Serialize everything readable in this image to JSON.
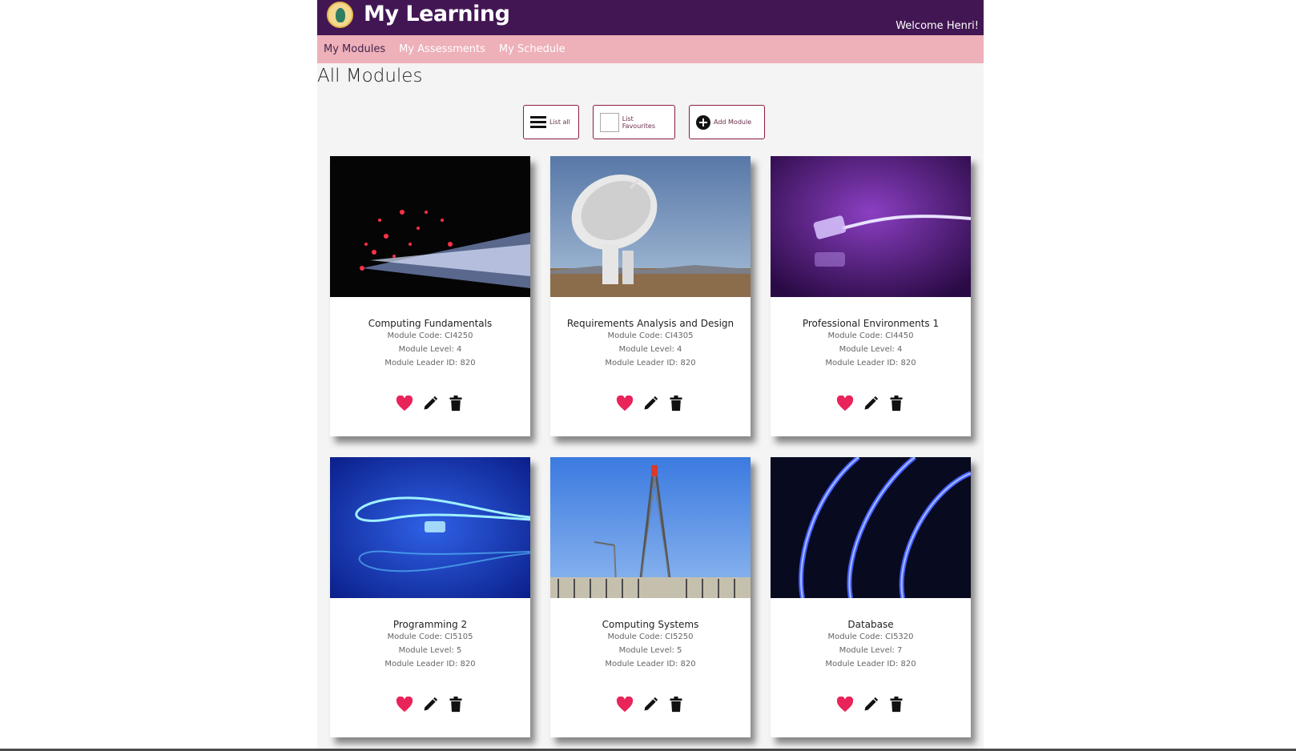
{
  "header": {
    "title": "My Learning",
    "welcome": "Welcome Henri!"
  },
  "nav": {
    "items": [
      "My Modules",
      "My Assessments",
      "My Schedule"
    ]
  },
  "page": {
    "title": "All Modules"
  },
  "actions": {
    "list_all": "List all",
    "list_favourites": "List Favourites",
    "add_module": "Add Module"
  },
  "modules": [
    {
      "name": "Computing Fundamentals",
      "code": "Module Code: CI4250",
      "level": "Module Level: 4",
      "leader": "Module Leader ID: 820"
    },
    {
      "name": "Requirements Analysis and Design",
      "code": "Module Code: CI4305",
      "level": "Module Level: 4",
      "leader": "Module Leader ID: 820"
    },
    {
      "name": "Professional Environments 1",
      "code": "Module Code: CI4450",
      "level": "Module Level: 4",
      "leader": "Module Leader ID: 820"
    },
    {
      "name": "Programming 2",
      "code": "Module Code: CI5105",
      "level": "Module Level: 5",
      "leader": "Module Leader ID: 820"
    },
    {
      "name": "Computing Systems",
      "code": "Module Code: CI5250",
      "level": "Module Level: 5",
      "leader": "Module Leader ID: 820"
    },
    {
      "name": "Database",
      "code": "Module Code: CI5320",
      "level": "Module Level: 7",
      "leader": "Module Leader ID: 820"
    }
  ],
  "colors": {
    "header": "#421653",
    "nav": "#eeb0b9",
    "heart": "#e8245a",
    "button_border": "#8a1e3a"
  }
}
